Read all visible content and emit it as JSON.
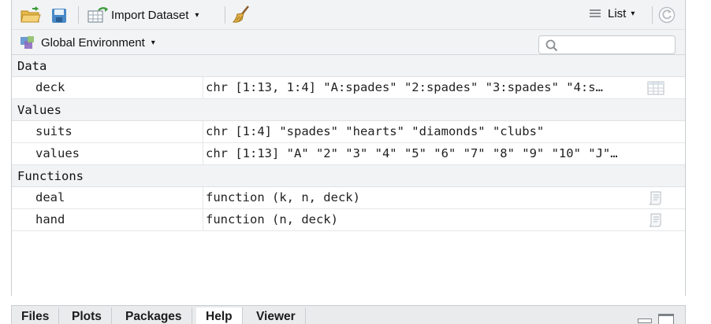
{
  "toolbar": {
    "import_label": "Import Dataset",
    "view_label": "List"
  },
  "environment": {
    "selector_label": "Global Environment",
    "search_placeholder": ""
  },
  "sections": {
    "data": "Data",
    "values": "Values",
    "functions": "Functions"
  },
  "rows": {
    "deck": {
      "name": "deck",
      "value": "chr [1:13, 1:4] \"A:spades\" \"2:spades\" \"3:spades\" \"4:s…"
    },
    "suits": {
      "name": "suits",
      "value": "chr [1:4] \"spades\" \"hearts\" \"diamonds\" \"clubs\""
    },
    "values": {
      "name": "values",
      "value": "chr [1:13] \"A\" \"2\" \"3\" \"4\" \"5\" \"6\" \"7\" \"8\" \"9\" \"10\" \"J\"…"
    },
    "deal": {
      "name": "deal",
      "value": "function (k, n, deck)"
    },
    "hand": {
      "name": "hand",
      "value": "function (n, deck)"
    }
  },
  "bottom_tabs": [
    "Files",
    "Plots",
    "Packages",
    "Help",
    "Viewer"
  ],
  "colors": {
    "toolbar_bg": "#f2f3f4",
    "accent_blue": "#4a89c8",
    "accent_green": "#3a9a3a"
  }
}
